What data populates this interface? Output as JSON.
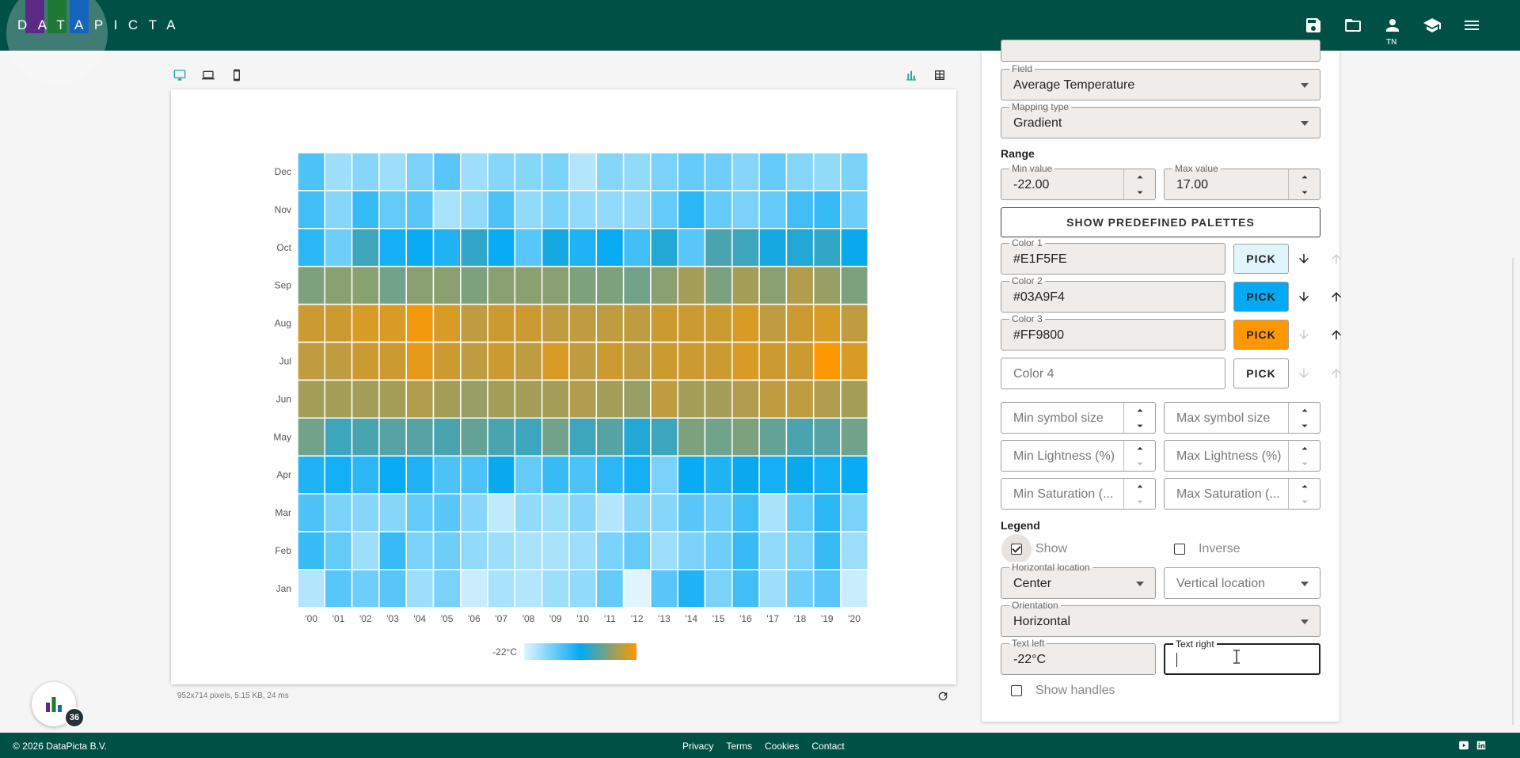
{
  "header": {
    "logo_text": "DATAPICTA",
    "logo_colors": [
      "#5b2a86",
      "#1e7a32",
      "#1565c0"
    ],
    "icons": [
      "save-icon",
      "folder-open-icon",
      "account-icon",
      "school-icon",
      "menu-icon"
    ],
    "user_initials": "TN"
  },
  "toolbar": {
    "device_icons": [
      "desktop-icon",
      "laptop-icon",
      "phone-icon"
    ],
    "active_device": "desktop",
    "view_icons": [
      "bar-chart-icon",
      "table-icon"
    ]
  },
  "chart_meta": "952x714 pixels, 5.15 KB, 24 ms",
  "chart_data": {
    "type": "heatmap",
    "x_labels": [
      "'00",
      "'01",
      "'02",
      "'03",
      "'04",
      "'05",
      "'06",
      "'07",
      "'08",
      "'09",
      "'10",
      "'11",
      "'12",
      "'13",
      "'14",
      "'15",
      "'16",
      "'17",
      "'18",
      "'19",
      "'20"
    ],
    "y_labels": [
      "Dec",
      "Nov",
      "Oct",
      "Sep",
      "Aug",
      "Jul",
      "Jun",
      "May",
      "Apr",
      "Mar",
      "Feb",
      "Jan"
    ],
    "color_stops": [
      "#E1F5FE",
      "#03A9F4",
      "#FF9800"
    ],
    "range": [
      -22,
      17
    ],
    "values": [
      [
        -9,
        -16,
        -14,
        -16,
        -13,
        -10,
        -16,
        -14,
        -14,
        -13,
        -18,
        -14,
        -15,
        -13,
        -11,
        -12,
        -14,
        -11,
        -14,
        -15,
        -13
      ],
      [
        -8,
        -14,
        -7,
        -11,
        -10,
        -17,
        -15,
        -9,
        -15,
        -13,
        -15,
        -15,
        -15,
        -11,
        -6,
        -11,
        -13,
        -11,
        -8,
        -7,
        -12
      ],
      [
        -6,
        -12,
        2,
        -4,
        -3,
        -5,
        1,
        -3,
        -10,
        -1,
        -5,
        -3,
        -8,
        0,
        -10,
        3,
        2,
        -1,
        0,
        1,
        -2
      ],
      [
        7,
        8,
        8,
        6,
        8,
        8,
        7,
        8,
        8,
        8,
        7,
        7,
        6,
        8,
        10,
        7,
        10,
        8,
        11,
        9,
        7
      ],
      [
        13,
        13,
        14,
        14,
        16,
        14,
        12,
        13,
        13,
        12,
        12,
        12,
        12,
        13,
        13,
        13,
        14,
        12,
        13,
        14,
        12
      ],
      [
        12,
        12,
        13,
        13,
        15,
        13,
        12,
        13,
        12,
        14,
        12,
        13,
        12,
        13,
        13,
        13,
        14,
        13,
        13,
        17,
        14
      ],
      [
        10,
        10,
        10,
        10,
        11,
        10,
        9,
        10,
        10,
        10,
        11,
        10,
        9,
        12,
        10,
        10,
        11,
        12,
        12,
        11,
        10
      ],
      [
        6,
        2,
        3,
        4,
        4,
        3,
        5,
        3,
        2,
        6,
        2,
        4,
        0,
        2,
        7,
        6,
        7,
        5,
        3,
        4,
        6
      ],
      [
        -5,
        -4,
        -6,
        -3,
        -5,
        -9,
        -9,
        -2,
        -11,
        -7,
        -9,
        -6,
        -4,
        -13,
        -3,
        -5,
        -2,
        -4,
        -2,
        -4,
        -3
      ],
      [
        -9,
        -13,
        -14,
        -14,
        -11,
        -10,
        -14,
        -19,
        -15,
        -16,
        -14,
        -18,
        -14,
        -14,
        -10,
        -12,
        -8,
        -17,
        -11,
        -6,
        -13
      ],
      [
        -7,
        -11,
        -16,
        -7,
        -13,
        -12,
        -15,
        -16,
        -17,
        -17,
        -16,
        -13,
        -11,
        -16,
        -13,
        -12,
        -7,
        -15,
        -13,
        -7,
        -16
      ],
      [
        -18,
        -10,
        -12,
        -10,
        -16,
        -13,
        -20,
        -17,
        -18,
        -16,
        -15,
        -11,
        -22,
        -10,
        -5,
        -13,
        -8,
        -16,
        -12,
        -10,
        -20
      ]
    ],
    "legend": {
      "placement": "bottom-center",
      "orientation": "horizontal",
      "text_left": "-22°C"
    }
  },
  "panel": {
    "field_label": "Field",
    "field_value": "Average Temperature",
    "mapping_label": "Mapping type",
    "mapping_value": "Gradient",
    "range_title": "Range",
    "min_label": "Min value",
    "min_value": "-22.00",
    "max_label": "Max value",
    "max_value": "17.00",
    "palettes_button": "SHOW PREDEFINED PALETTES",
    "colors": [
      {
        "label": "Color 1",
        "value": "#E1F5FE",
        "swatch": "#E1F5FE",
        "pick": "PICK"
      },
      {
        "label": "Color 2",
        "value": "#03A9F4",
        "swatch": "#03A9F4",
        "pick": "PICK"
      },
      {
        "label": "Color 3",
        "value": "#FF9800",
        "swatch": "#FF9800",
        "pick": "PICK"
      }
    ],
    "color4_placeholder": "Color 4",
    "color4_pick": "PICK",
    "min_symbol_size": "Min symbol size",
    "max_symbol_size": "Max symbol size",
    "min_lightness": "Min Lightness (%)",
    "max_lightness": "Max Lightness (%)",
    "min_saturation": "Min Saturation (...",
    "max_saturation": "Max Saturation (...",
    "legend_title": "Legend",
    "show_label": "Show",
    "inverse_label": "Inverse",
    "hloc_label": "Horizontal location",
    "hloc_value": "Center",
    "vloc_placeholder": "Vertical location",
    "orientation_label": "Orientation",
    "orientation_value": "Horizontal",
    "text_left_label": "Text left",
    "text_left_value": "-22°C",
    "text_right_label": "Text right",
    "text_right_value": "",
    "show_handles_label": "Show handles"
  },
  "footer": {
    "copyright": "© 2026 DataPicta B.V.",
    "links": [
      "Privacy",
      "Terms",
      "Cookies",
      "Contact"
    ],
    "social": [
      "youtube-icon",
      "linkedin-icon"
    ]
  },
  "fab": {
    "count": "36"
  }
}
